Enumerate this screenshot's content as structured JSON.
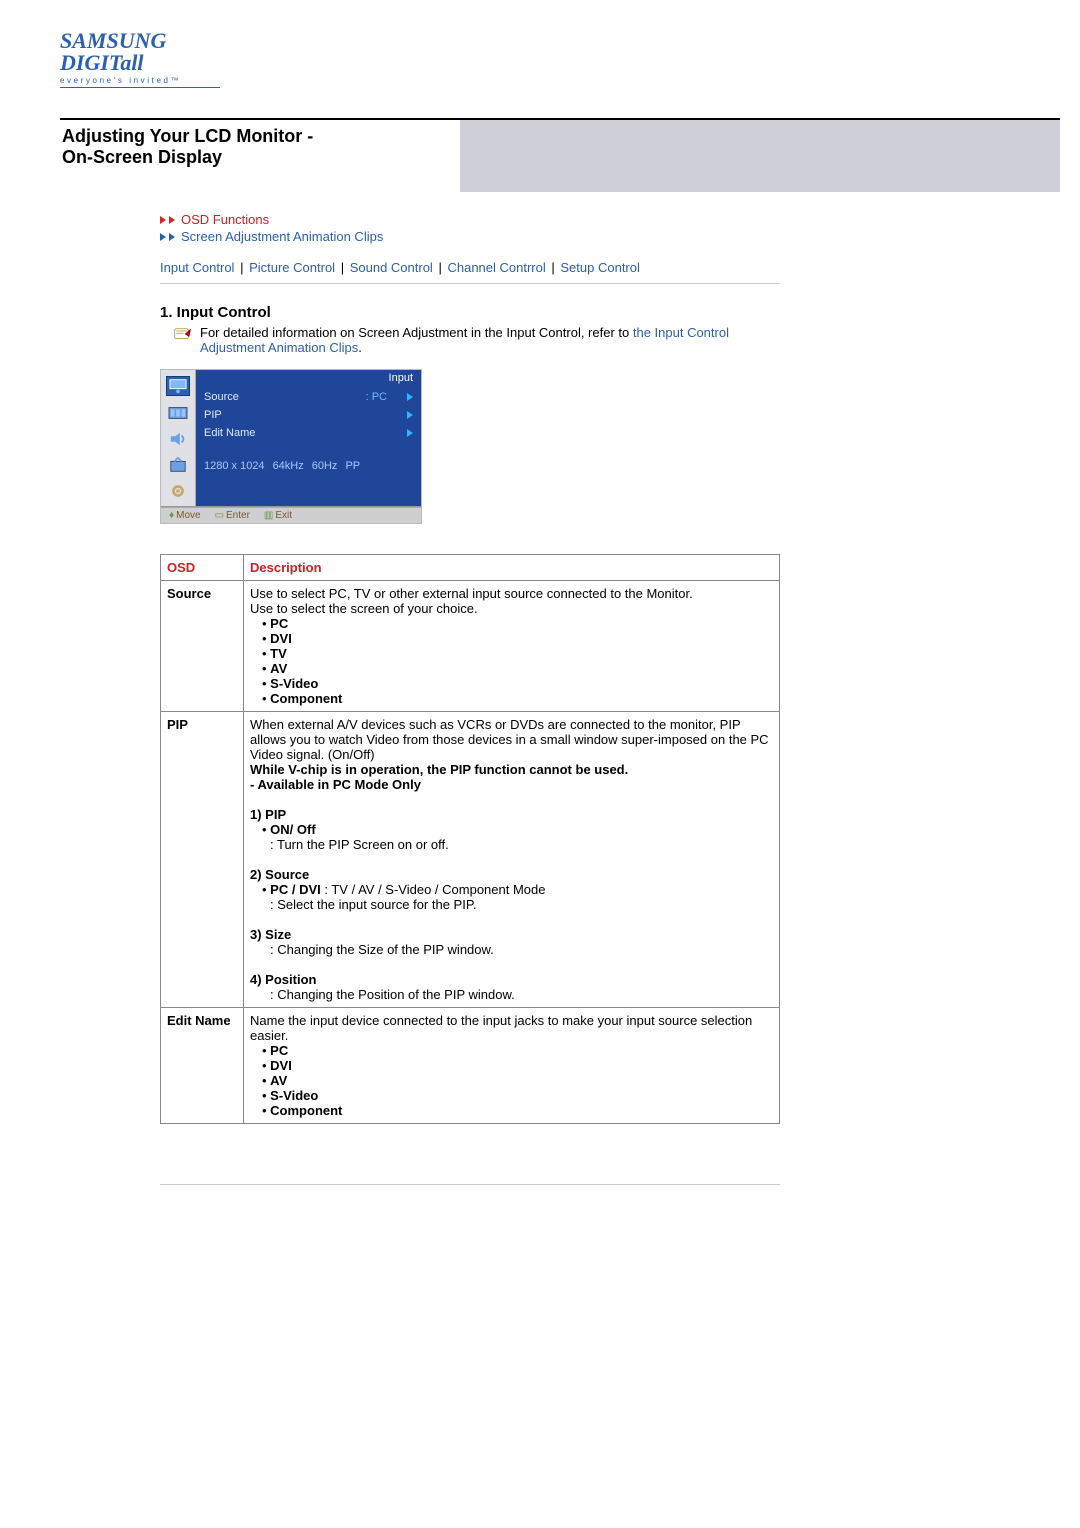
{
  "brand": {
    "name": "SAMSUNG DIGITall",
    "tagline": "everyone's invited™"
  },
  "header": {
    "title1": "Adjusting Your LCD Monitor  -",
    "title2": "On-Screen Display"
  },
  "nav": {
    "osd_functions": "OSD Functions",
    "screen_clips": "Screen Adjustment Animation Clips"
  },
  "tabs": {
    "input": "Input Control",
    "picture": "Picture Control",
    "sound": "Sound Control",
    "channel": "Channel Contrrol",
    "setup": "Setup Control",
    "sep": "|"
  },
  "section1": {
    "heading": "1. Input Control",
    "intro_prefix": "For detailed information on Screen Adjustment in the Input Control, refer to ",
    "intro_link": "the Input Control Adjustment Animation Clips",
    "intro_suffix": "."
  },
  "osd": {
    "menu_title": "Input",
    "rows": [
      {
        "label": "Source",
        "value": ": PC"
      },
      {
        "label": "PIP",
        "value": ""
      },
      {
        "label": "Edit Name",
        "value": ""
      }
    ],
    "status": {
      "res": "1280 x 1024",
      "h": "64kHz",
      "v": "60Hz",
      "mode": "PP"
    },
    "foot": {
      "move": "Move",
      "enter": "Enter",
      "exit": "Exit"
    }
  },
  "table": {
    "col_osd": "OSD",
    "col_desc": "Description",
    "source": {
      "name": "Source",
      "d1": "Use to select PC, TV or other external input source connected to the Monitor.",
      "d2": "Use to select the screen of your choice.",
      "b1": "PC",
      "b2": "DVI",
      "b3": "TV",
      "b4": "AV",
      "b5": "S-Video",
      "b6": "Component"
    },
    "pip": {
      "name": "PIP",
      "d1": "When external A/V devices such as VCRs or DVDs are connected to the monitor, PIP allows you to watch Video from those devices in a small window super-imposed on the PC Video signal. (On/Off)",
      "d2": "While V-chip is in operation, the PIP function cannot be used.",
      "d3": "- Available in PC Mode Only",
      "s1h": "1) PIP",
      "s1a": "ON/ Off",
      "s1b": ": Turn the PIP Screen on or off.",
      "s2h": "2) Source",
      "s2a_b": "PC / DVI",
      "s2a_r": " : TV / AV / S-Video / Component Mode",
      "s2b": ": Select the input source for the PIP.",
      "s3h": "3) Size",
      "s3a": ": Changing the Size of the PIP window.",
      "s4h": "4) Position",
      "s4a": ": Changing the Position of the PIP window."
    },
    "edit": {
      "name": "Edit Name",
      "d1": "Name the input device connected to the input jacks to make your input source selection easier.",
      "b1": "PC",
      "b2": "DVI",
      "b3": "AV",
      "b4": "S-Video",
      "b5": "Component"
    }
  }
}
